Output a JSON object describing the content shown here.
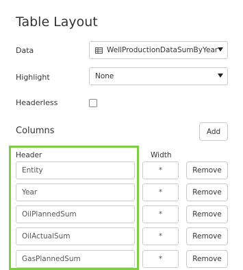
{
  "panel": {
    "title": "Table Layout"
  },
  "form": {
    "data_label": "Data",
    "data_value": "WellProductionDataSumByYear",
    "data_icon": "table-icon",
    "highlight_label": "Highlight",
    "highlight_value": "None",
    "headerless_label": "Headerless",
    "headerless_checked": false
  },
  "columns": {
    "title": "Columns",
    "add_label": "Add",
    "header_col_label": "Header",
    "width_col_label": "Width",
    "remove_label": "Remove",
    "rows": [
      {
        "header": "Entity",
        "width": "*"
      },
      {
        "header": "Year",
        "width": "*"
      },
      {
        "header": "OilPlannedSum",
        "width": "*"
      },
      {
        "header": "OilActualSum",
        "width": "*"
      },
      {
        "header": "GasPlannedSum",
        "width": "*"
      }
    ]
  },
  "colors": {
    "highlight_frame": "#7fcd47",
    "border": "#cccccc"
  }
}
